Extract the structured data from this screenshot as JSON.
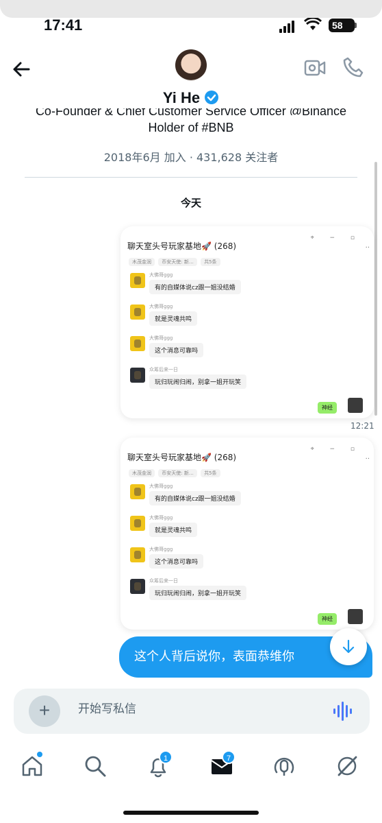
{
  "status": {
    "time": "17:41",
    "battery": "58"
  },
  "header": {
    "name": "Yi He",
    "bio_cut": "Co-Founder & Chief Customer Service Officer @Binance",
    "bio": "Holder of #BNB",
    "joined": "2018年6月 加入 · 431,628 关注者"
  },
  "chat": {
    "day": "今天",
    "screenshots": [
      {
        "title": "聊天室头号玩家基地🚀 (268)",
        "tags": [
          "木茂金润",
          "币安天使: 新…",
          "共5条"
        ],
        "messages": [
          {
            "nick": "大佛哥ggg",
            "text": "有的自媒体说cz跟一姐没结婚"
          },
          {
            "nick": "大佛哥ggg",
            "text": "就是灵魂共鸣"
          },
          {
            "nick": "大佛哥ggg",
            "text": "这个消息可靠吗"
          },
          {
            "nick": "众筹后来一日",
            "text": "玩归玩闹归闹，别拿一姐开玩笑"
          }
        ],
        "reply": "神经"
      },
      {
        "title": "聊天室头号玩家基地🚀 (268)",
        "tags": [
          "木茂金润",
          "币安天使: 新…",
          "共5条"
        ],
        "messages": [
          {
            "nick": "大佛哥ggg",
            "text": "有的自媒体说cz跟一姐没结婚"
          },
          {
            "nick": "大佛哥ggg",
            "text": "就是灵魂共鸣"
          },
          {
            "nick": "大佛哥ggg",
            "text": "这个消息可靠吗"
          },
          {
            "nick": "众筹后来一日",
            "text": "玩归玩闹归闹，别拿一姐开玩笑"
          }
        ],
        "reply": "神经"
      }
    ],
    "timestamp": "12:21",
    "sent_message": "这个人背后说你，表面恭维你"
  },
  "composer": {
    "placeholder": "开始写私信",
    "plus": "+"
  },
  "tabs": {
    "notifications_badge": "1",
    "messages_badge": "7"
  },
  "colors": {
    "accent": "#1d9bf0",
    "wechat_green": "#95ec69"
  }
}
